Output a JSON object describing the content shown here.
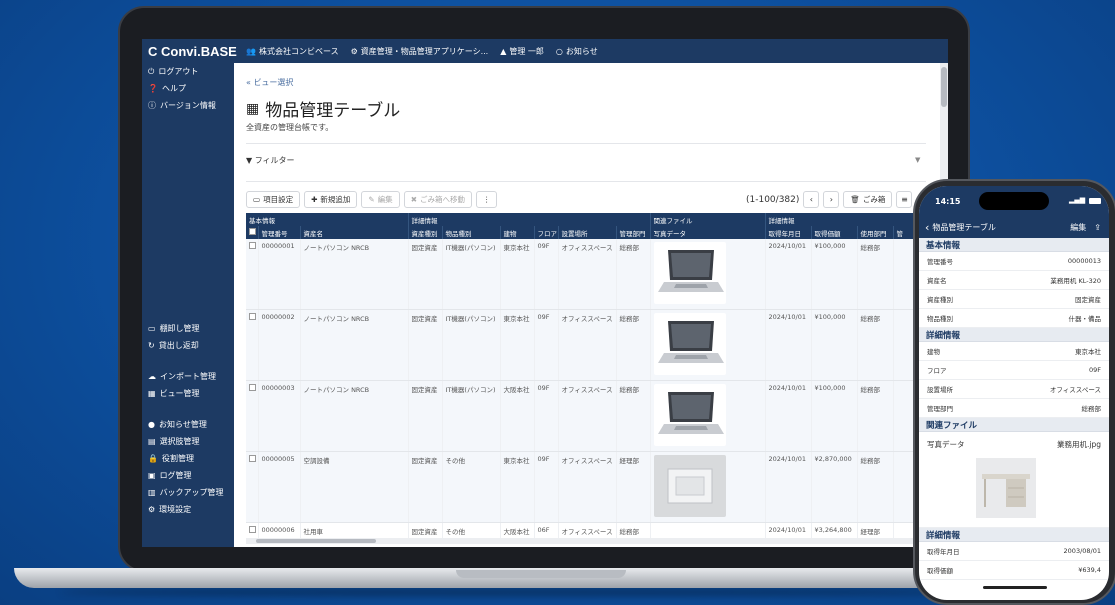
{
  "app": {
    "logo": "Convi.BASE",
    "topbar": [
      {
        "icon": "users-icon",
        "label": "株式会社コンビベース"
      },
      {
        "icon": "gear-icon",
        "label": "資産管理・物品管理アプリケーシ..."
      },
      {
        "icon": "user-icon",
        "label": "管理 一郎"
      },
      {
        "icon": "chat-icon",
        "label": "お知らせ"
      }
    ]
  },
  "sidebar": {
    "top": [
      {
        "icon": "power-icon",
        "label": "ログアウト"
      },
      {
        "icon": "help-icon",
        "label": "ヘルプ"
      },
      {
        "icon": "info-icon",
        "label": "バージョン情報"
      }
    ],
    "group1": [
      {
        "icon": "monitor-icon",
        "label": "棚卸し管理"
      },
      {
        "icon": "refresh-icon",
        "label": "貸出し返却"
      }
    ],
    "group2": [
      {
        "icon": "cloud-icon",
        "label": "インポート管理"
      },
      {
        "icon": "grid-icon",
        "label": "ビュー管理"
      }
    ],
    "group3": [
      {
        "icon": "chat-icon",
        "label": "お知らせ管理"
      },
      {
        "icon": "list-icon",
        "label": "選択肢管理"
      },
      {
        "icon": "lock-icon",
        "label": "役割管理"
      },
      {
        "icon": "log-icon",
        "label": "ログ管理"
      },
      {
        "icon": "database-icon",
        "label": "バックアップ管理"
      },
      {
        "icon": "cogs-icon",
        "label": "環境設定"
      }
    ]
  },
  "main": {
    "breadcrumb": "« ビュー選択",
    "title": "物品管理テーブル",
    "description": "全資産の管理台帳です。",
    "filter_label": "フィルター",
    "toolbar": {
      "settings": "項目設定",
      "add": "新規追加",
      "edit": "編集",
      "trash": "ごみ箱へ移動",
      "more": "⋮"
    },
    "pager": {
      "range": "(1-100/382)",
      "prev": "‹",
      "next": "›",
      "trashbox": "ごみ箱"
    },
    "table": {
      "groups": [
        "基本情報",
        "詳細情報",
        "関連ファイル",
        "詳細情報"
      ],
      "columns": [
        "管理番号",
        "資産名",
        "資産種別",
        "物品種別",
        "建物",
        "フロア",
        "設置場所",
        "管理部門",
        "写真データ",
        "取得年月日",
        "取得価額",
        "使用部門",
        "管"
      ],
      "rows": [
        {
          "id": "00000001",
          "name": "ノートパソコン NRCB",
          "type": "固定資産",
          "kind": "IT機器(パソコン)",
          "bldg": "東京本社",
          "floor": "09F",
          "place": "オフィススペース",
          "dept": "総務部",
          "photo": "laptop",
          "date": "2024/10/01",
          "price": "¥100,000",
          "use": "総務部"
        },
        {
          "id": "00000002",
          "name": "ノートパソコン NRCB",
          "type": "固定資産",
          "kind": "IT機器(パソコン)",
          "bldg": "東京本社",
          "floor": "09F",
          "place": "オフィススペース",
          "dept": "総務部",
          "photo": "laptop",
          "date": "2024/10/01",
          "price": "¥100,000",
          "use": "総務部"
        },
        {
          "id": "00000003",
          "name": "ノートパソコン NRCB",
          "type": "固定資産",
          "kind": "IT機器(パソコン)",
          "bldg": "大阪本社",
          "floor": "09F",
          "place": "オフィススペース",
          "dept": "総務部",
          "photo": "laptop",
          "date": "2024/10/01",
          "price": "¥100,000",
          "use": "総務部"
        },
        {
          "id": "00000005",
          "name": "空調設備",
          "type": "固定資産",
          "kind": "その他",
          "bldg": "東京本社",
          "floor": "09F",
          "place": "オフィススペース",
          "dept": "経理部",
          "photo": "aircon",
          "date": "2024/10/01",
          "price": "¥2,870,000",
          "use": "総務部"
        },
        {
          "id": "00000006",
          "name": "社用車",
          "type": "固定資産",
          "kind": "その他",
          "bldg": "大阪本社",
          "floor": "06F",
          "place": "オフィススペース",
          "dept": "総務部",
          "photo": "",
          "date": "2024/10/01",
          "price": "¥3,264,800",
          "use": "経理部"
        }
      ]
    }
  },
  "phone": {
    "time": "14:15",
    "nav_title": "物品管理テーブル",
    "nav_edit": "編集",
    "sections": [
      {
        "title": "基本情報",
        "rows": [
          [
            "管理番号",
            "00000013"
          ],
          [
            "資産名",
            "業務用机 KL-320"
          ],
          [
            "資産種別",
            "固定資産"
          ],
          [
            "物品種別",
            "什器・備品"
          ]
        ]
      },
      {
        "title": "詳細情報",
        "rows": [
          [
            "建物",
            "東京本社"
          ],
          [
            "フロア",
            "09F"
          ],
          [
            "設置場所",
            "オフィススペース"
          ],
          [
            "管理部門",
            "総務部"
          ]
        ]
      }
    ],
    "files_title": "関連ファイル",
    "photo_label": "写真データ",
    "photo_file": "業務用机.jpg",
    "detail_title": "詳細情報",
    "detail_rows": [
      [
        "取得年月日",
        "2003/08/01"
      ],
      [
        "取得価額",
        "¥639,4"
      ]
    ]
  },
  "colors": {
    "background": "#0d4f9e",
    "app_navy": "#1d3a63",
    "accent": "#4a6ea0"
  }
}
